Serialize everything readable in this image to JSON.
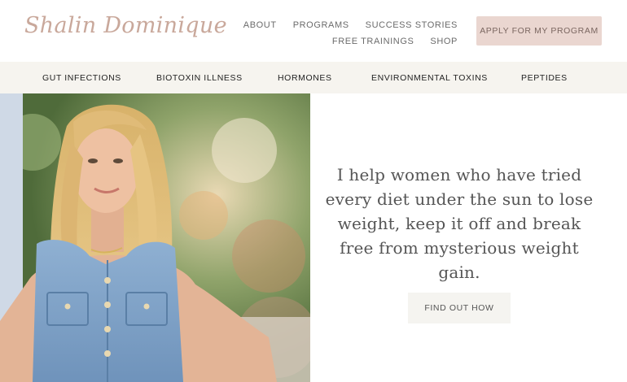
{
  "header": {
    "logo": "Shalin Dominique",
    "nav": {
      "row1": [
        "ABOUT",
        "PROGRAMS",
        "SUCCESS STORIES"
      ],
      "row2": [
        "FREE TRAININGS",
        "SHOP"
      ]
    },
    "cta_label": "APPLY FOR MY PROGRAM"
  },
  "categories": [
    "GUT INFECTIONS",
    "BIOTOXIN ILLNESS",
    "HORMONES",
    "ENVIRONMENTAL TOXINS",
    "PEPTIDES"
  ],
  "hero": {
    "headline": "I help women who have tried every diet under the sun to lose weight, keep it off and break free from mysterious weight gain.",
    "button_label": "FIND OUT HOW",
    "image": "woman-in-denim-vest-photo"
  },
  "colors": {
    "logo": "#c9a89b",
    "cta_bg": "#ead6d0",
    "catbar_bg": "#f6f4ef",
    "button_bg": "#f5f4f0"
  }
}
